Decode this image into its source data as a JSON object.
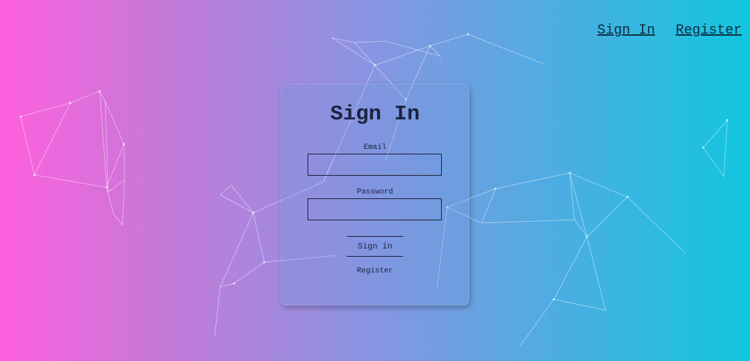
{
  "nav": {
    "sign_in": "Sign In",
    "register": "Register"
  },
  "form": {
    "title": "Sign In",
    "email_label": "Email",
    "email_value": "",
    "password_label": "Password",
    "password_value": "",
    "submit_label": "Sign in",
    "register_label": "Register"
  },
  "colors": {
    "gradient_left": "#ff5fdd",
    "gradient_right": "#12c6e0",
    "text_dark": "#1c2340"
  }
}
